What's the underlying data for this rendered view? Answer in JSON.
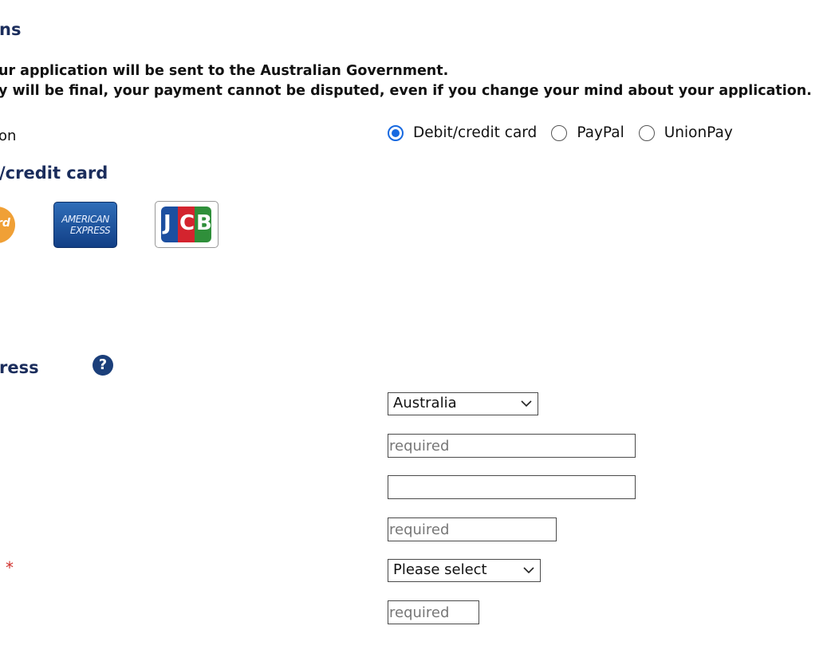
{
  "section": {
    "title": "ns",
    "notice_line1": "ur application will be sent to the Australian Government.",
    "notice_line2": "y will be final, your payment cannot be disputed, even if you change your mind about your application."
  },
  "payment_option": {
    "label": "on",
    "options": [
      {
        "label": "Debit/credit card",
        "checked": true
      },
      {
        "label": "PayPal",
        "checked": false
      },
      {
        "label": "UnionPay",
        "checked": false
      }
    ]
  },
  "card_section": {
    "title": "/credit card",
    "logos": [
      {
        "name": "mastercard-logo",
        "text": "rd"
      },
      {
        "name": "american-express-logo",
        "text_top": "AMERICAN",
        "text_bottom": "EXPRESS"
      },
      {
        "name": "jcb-logo",
        "letters": [
          "J",
          "C",
          "B"
        ]
      }
    ]
  },
  "address_section": {
    "title": "ress",
    "help_icon": "?",
    "required_marker": "*",
    "country_select": {
      "value": "Australia"
    },
    "address_line1": {
      "value": "",
      "placeholder": "required"
    },
    "address_line2": {
      "value": "",
      "placeholder": ""
    },
    "suburb": {
      "value": "",
      "placeholder": "required"
    },
    "state_select": {
      "value": "Please select"
    },
    "postcode": {
      "value": "",
      "placeholder": "required"
    }
  },
  "colors": {
    "heading": "#1b2d5c",
    "radio_accent": "#1769e0",
    "required_star": "#d0312d",
    "help_icon_bg": "#1b3f7a"
  }
}
